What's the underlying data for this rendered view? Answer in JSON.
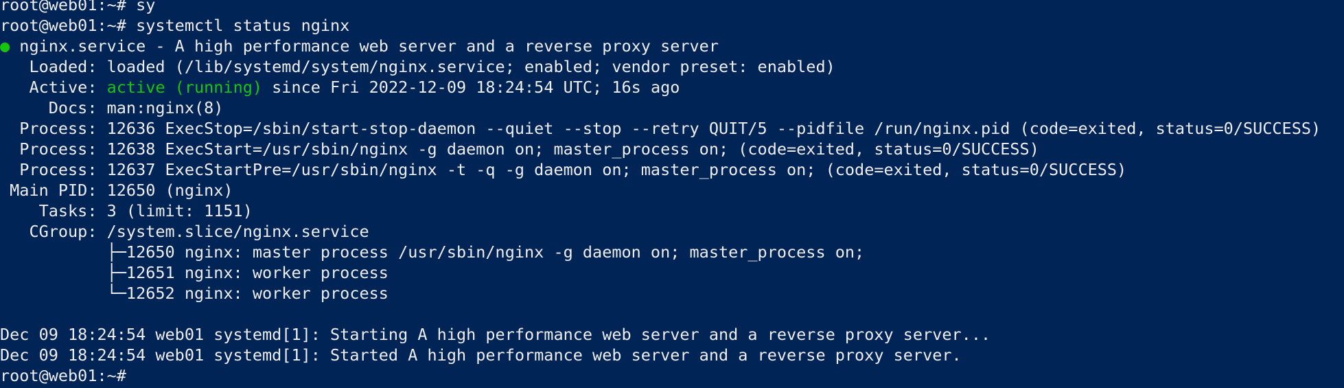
{
  "terminal": {
    "background": "#012456",
    "foreground": "#eeedf0",
    "accent_green": "#16c60c",
    "lines": [
      "root@web01:~# sy",
      "root@web01:~# systemctl status nginx",
      "● nginx.service - A high performance web server and a reverse proxy server",
      "   Loaded: loaded (/lib/systemd/system/nginx.service; enabled; vendor preset: enabled)",
      "   Active: ",
      "     Docs: man:nginx(8)",
      "  Process: 12636 ExecStop=/sbin/start-stop-daemon --quiet --stop --retry QUIT/5 --pidfile /run/nginx.pid (code=exited, status=0/SUCCESS)",
      "  Process: 12638 ExecStart=/usr/sbin/nginx -g daemon on; master_process on; (code=exited, status=0/SUCCESS)",
      "  Process: 12637 ExecStartPre=/usr/sbin/nginx -t -q -g daemon on; master_process on; (code=exited, status=0/SUCCESS)",
      " Main PID: 12650 (nginx)",
      "    Tasks: 3 (limit: 1151)",
      "   CGroup: /system.slice/nginx.service",
      "           ├─12650 nginx: master process /usr/sbin/nginx -g daemon on; master_process on;",
      "           ├─12651 nginx: worker process",
      "           └─12652 nginx: worker process",
      "",
      "Dec 09 18:24:54 web01 systemd[1]: Starting A high performance web server and a reverse proxy server...",
      "Dec 09 18:24:54 web01 systemd[1]: Started A high performance web server and a reverse proxy server.",
      "root@web01:~# "
    ],
    "status_dot": "●",
    "nginx_service_line": " nginx.service - A high performance web server and a reverse proxy server",
    "active_label": "   Active: ",
    "active_state": "active (running)",
    "active_since": " since Fri 2022-12-09 18:24:54 UTC; 16s ago",
    "prompt": "root@web01:~# "
  }
}
